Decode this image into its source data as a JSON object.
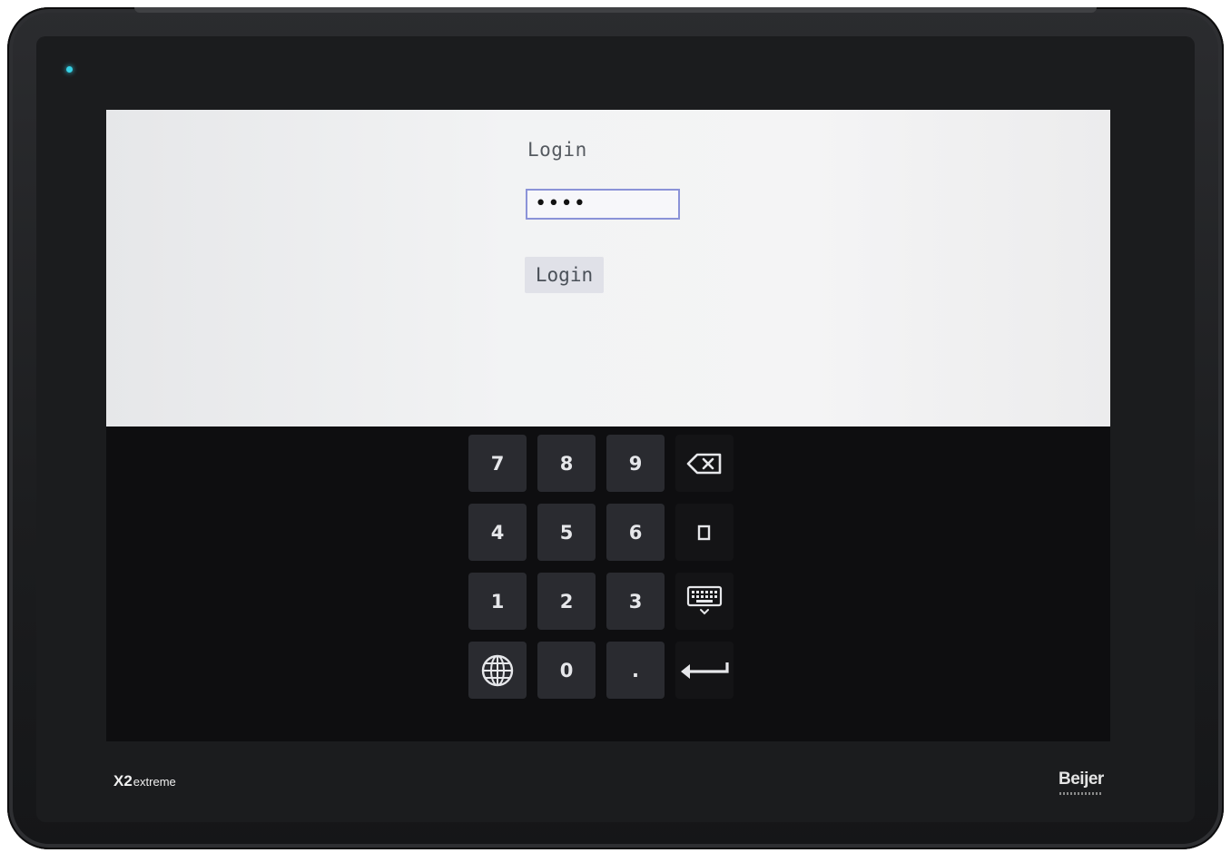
{
  "device": {
    "model_label": "X2",
    "model_suffix": "extreme",
    "brand": "Beijer",
    "led_color": "#36d1e6"
  },
  "login": {
    "title": "Login",
    "password_value": "••••",
    "button_label": "Login"
  },
  "keypad": {
    "keys": [
      {
        "label": "7"
      },
      {
        "label": "8"
      },
      {
        "label": "9"
      },
      {
        "icon": "backspace-icon"
      },
      {
        "label": "4"
      },
      {
        "label": "5"
      },
      {
        "label": "6"
      },
      {
        "icon": "square-icon"
      },
      {
        "label": "1"
      },
      {
        "label": "2"
      },
      {
        "label": "3"
      },
      {
        "icon": "keyboard-hide-icon"
      },
      {
        "icon": "globe-icon"
      },
      {
        "label": "0"
      },
      {
        "label": "."
      },
      {
        "icon": "enter-icon"
      }
    ]
  },
  "colors": {
    "panel_bg": "#f2f3f4",
    "field_border": "#8b93d8",
    "key_bg": "#2a2b30",
    "key_text": "#e6e7ea",
    "keypad_bg": "#0e0e10"
  }
}
